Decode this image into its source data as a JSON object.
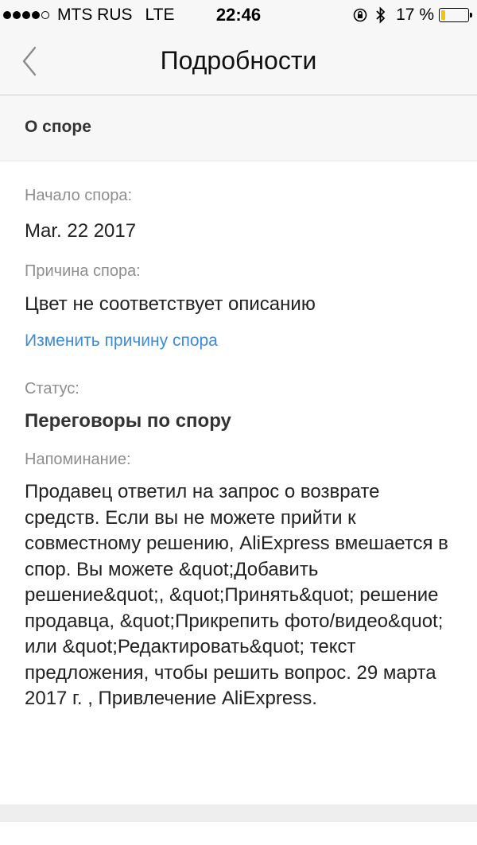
{
  "status_bar": {
    "carrier": "MTS RUS",
    "network": "LTE",
    "time": "22:46",
    "battery_percent": "17 %",
    "battery_level": 0.17,
    "battery_color": "#f5c400"
  },
  "nav": {
    "title": "Подробности",
    "back_icon": "chevron-left-icon"
  },
  "section": {
    "title": "О споре"
  },
  "dispute": {
    "start_label": "Начало спора:",
    "start_value": "Mar. 22 2017",
    "reason_label": "Причина спора:",
    "reason_value": "Цвет не соответствует описанию",
    "change_reason_link": "Изменить причину спора",
    "status_label": "Статус:",
    "status_value": "Переговоры по спору",
    "reminder_label": "Напоминание:",
    "reminder_text": "Продавец ответил на запрос о возврате средств. Если вы не можете прийти к совместному решению, AliExpress вмешается в спор. Вы можете &quot;Добавить решение&quot;, &quot;Принять&quot; решение продавца, &quot;Прикрепить фото/видео&quot; или &quot;Редактировать&quot; текст предложения, чтобы решить вопрос. 29 марта 2017 г. , Привлечение AliExpress."
  },
  "colors": {
    "link": "#3d8bd9",
    "label": "#8e8e8e",
    "nav_background": "#f7f7f7"
  }
}
